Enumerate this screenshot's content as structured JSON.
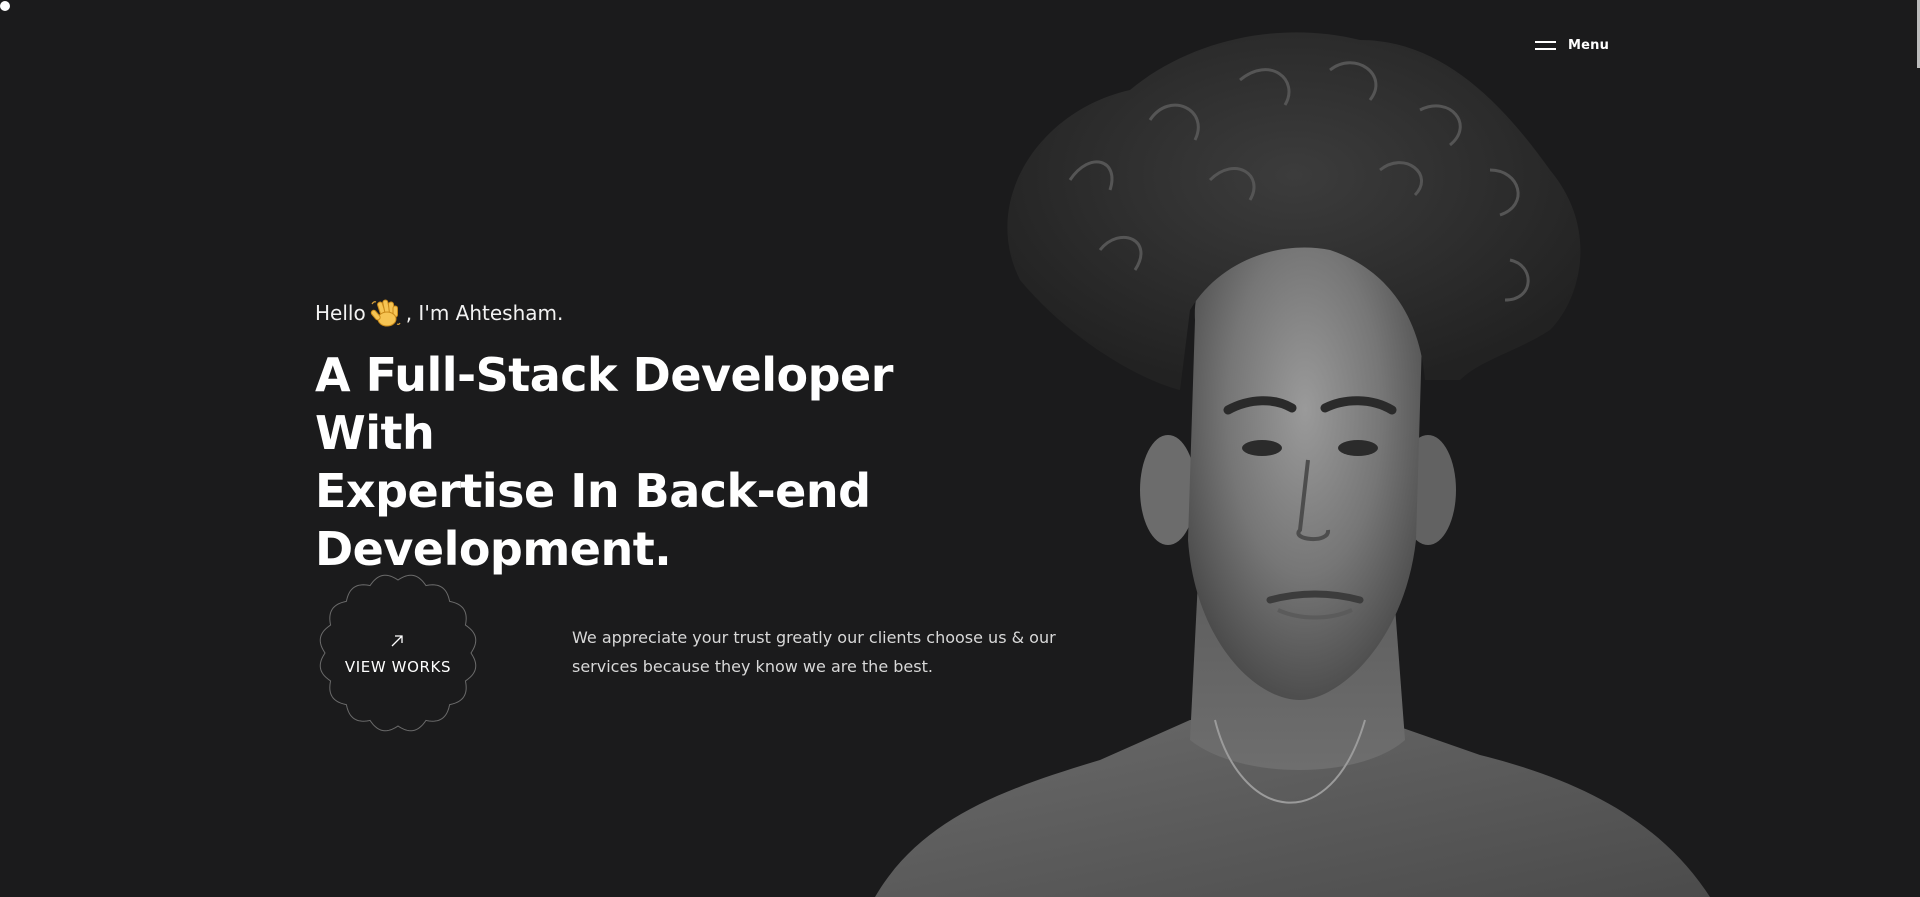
{
  "nav": {
    "menu_label": "Menu",
    "menu_icon": "hamburger-icon"
  },
  "hero": {
    "greeting_before": "Hello",
    "greeting_emoji": "waving-hand-icon",
    "greeting_after": ", I'm Ahtesham.",
    "headline_lines": [
      "A Full-Stack Developer With",
      "Expertise In Back-end",
      "Development."
    ],
    "cta_label": "VIEW WORKS",
    "cta_icon": "arrow-up-right-icon",
    "tagline": "We appreciate your trust greatly our clients choose us & our services because they know we are the best.",
    "portrait": "grayscale-portrait-photo"
  },
  "colors": {
    "background": "#1b1b1c",
    "text": "#ffffff",
    "muted_text": "#d8d8d8"
  }
}
